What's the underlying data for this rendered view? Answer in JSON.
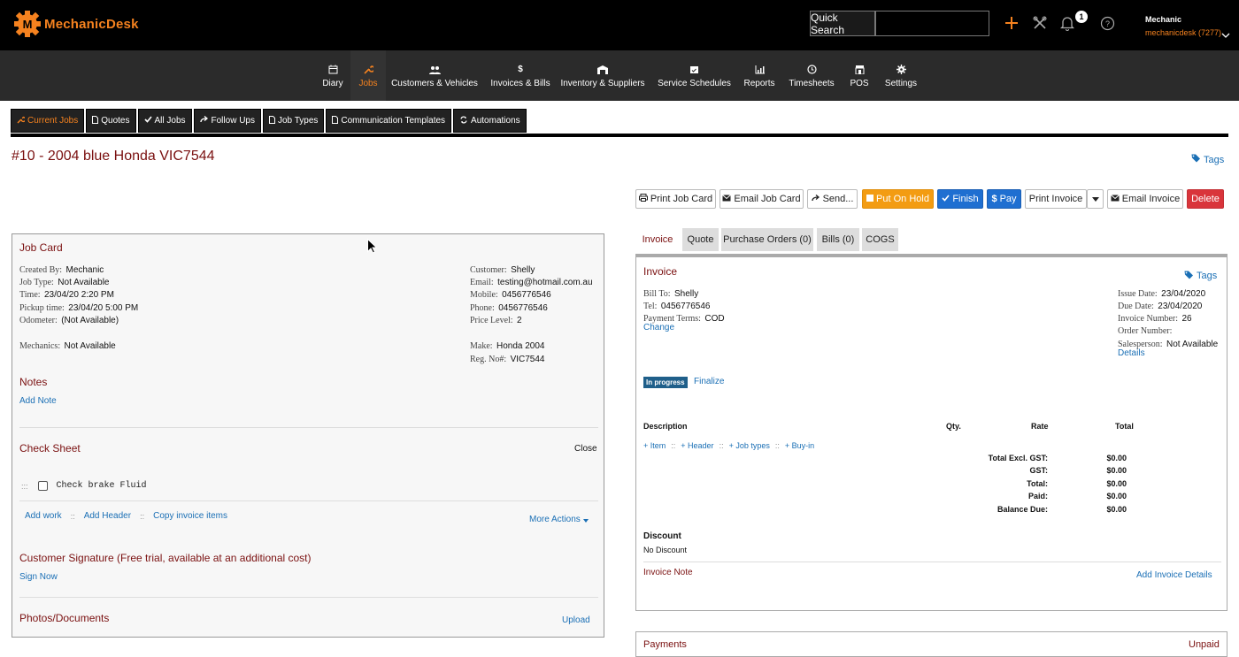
{
  "topbar": {
    "logo_text": "MechanicDesk",
    "quick_search_label": "Quick Search",
    "quick_search_value": "",
    "notification_count": "1",
    "user_name": "Mechanic",
    "user_account": "mechanicdesk (7277)",
    "brand_color": "#f5821f"
  },
  "nav": {
    "items": [
      {
        "label": "Diary",
        "icon": "calendar-icon"
      },
      {
        "label": "Jobs",
        "icon": "wrench-icon"
      },
      {
        "label": "Customers & Vehicles",
        "icon": "users-icon"
      },
      {
        "label": "Invoices & Bills",
        "icon": "dollar-icon"
      },
      {
        "label": "Inventory & Suppliers",
        "icon": "warehouse-icon"
      },
      {
        "label": "Service Schedules",
        "icon": "calendar-check-icon"
      },
      {
        "label": "Reports",
        "icon": "chart-icon"
      },
      {
        "label": "Timesheets",
        "icon": "clock-icon"
      },
      {
        "label": "POS",
        "icon": "store-icon"
      },
      {
        "label": "Settings",
        "icon": "gear-icon"
      }
    ],
    "active": "Jobs"
  },
  "subtabs": [
    {
      "label": "Current Jobs",
      "icon": "wrench-icon"
    },
    {
      "label": "Quotes",
      "icon": "file-icon"
    },
    {
      "label": "All Jobs",
      "icon": "check-icon"
    },
    {
      "label": "Follow Ups",
      "icon": "share-icon"
    },
    {
      "label": "Job Types",
      "icon": "file-icon"
    },
    {
      "label": "Communication Templates",
      "icon": "file-icon"
    },
    {
      "label": "Automations",
      "icon": "refresh-icon"
    }
  ],
  "page": {
    "title": "#10 - 2004 blue Honda VIC7544",
    "tags": "Tags"
  },
  "actions": {
    "print_job_card": "Print Job Card",
    "email_job_card": "Email Job Card",
    "send": "Send...",
    "put_on_hold": "Put On Hold",
    "finish": "Finish",
    "pay": "Pay",
    "print_invoice": "Print Invoice",
    "email_invoice": "Email Invoice",
    "delete": "Delete"
  },
  "jobcard": {
    "title": "Job Card",
    "created_by_label": "Created By:",
    "created_by": "Mechanic",
    "job_type_label": "Job Type:",
    "job_type": "Not Available",
    "time_label": "Time:",
    "time": "23/04/20 2:20 PM",
    "pickup_label": "Pickup time:",
    "pickup": "23/04/20 5:00 PM",
    "odometer_label": "Odometer:",
    "odometer": "(Not Available)",
    "mechanics_label": "Mechanics:",
    "mechanics": "Not Available",
    "customer_label": "Customer:",
    "customer": "Shelly",
    "email_label": "Email:",
    "email": "testing@hotmail.com.au",
    "mobile_label": "Mobile:",
    "mobile": "0456776546",
    "phone_label": "Phone:",
    "phone": "0456776546",
    "price_level_label": "Price Level:",
    "price_level": "2",
    "make_label": "Make:",
    "make": "Honda 2004",
    "reg_label": "Reg. No#:",
    "reg": "VIC7544",
    "notes_title": "Notes",
    "add_note": "Add Note",
    "check_sheet_title": "Check Sheet",
    "close": "Close",
    "check_item": "Check brake Fluid",
    "add_work": "Add work",
    "add_header": "Add Header",
    "copy_invoice_items": "Copy invoice items",
    "more_actions": "More Actions",
    "signature_title": "Customer Signature (Free trial, available at an additional cost)",
    "sign_now": "Sign Now",
    "photos_title": "Photos/Documents",
    "upload": "Upload"
  },
  "invoice_tabs": [
    "Invoice",
    "Quote",
    "Purchase Orders (0)",
    "Bills (0)",
    "COGS"
  ],
  "invoice": {
    "title": "Invoice",
    "tags": "Tags",
    "bill_to_label": "Bill To:",
    "bill_to": "Shelly",
    "tel_label": "Tel:",
    "tel": "0456776546",
    "terms_label": "Payment Terms:",
    "terms": "COD",
    "change": "Change",
    "issue_date_label": "Issue Date:",
    "issue_date": "23/04/2020",
    "due_date_label": "Due Date:",
    "due_date": "23/04/2020",
    "invoice_number_label": "Invoice Number:",
    "invoice_number": "26",
    "order_number_label": "Order Number:",
    "salesperson_label": "Salesperson:",
    "salesperson": "Not Available",
    "details": "Details",
    "status": "In progress",
    "finalize": "Finalize",
    "col_description": "Description",
    "col_qty": "Qty.",
    "col_rate": "Rate",
    "col_total": "Total",
    "add_item": "+ Item",
    "add_header": "+ Header",
    "add_job_types": "+ Job types",
    "add_buy_in": "+ Buy-in",
    "totals": [
      {
        "label": "Total Excl. GST:",
        "value": "$0.00"
      },
      {
        "label": "GST:",
        "value": "$0.00"
      },
      {
        "label": "Total:",
        "value": "$0.00"
      },
      {
        "label": "Paid:",
        "value": "$0.00"
      },
      {
        "label": "Balance Due:",
        "value": "$0.00"
      }
    ],
    "discount_title": "Discount",
    "discount_value": "No Discount",
    "invoice_note": "Invoice Note",
    "add_invoice_details": "Add Invoice Details"
  },
  "payments": {
    "title": "Payments",
    "status": "Unpaid"
  }
}
